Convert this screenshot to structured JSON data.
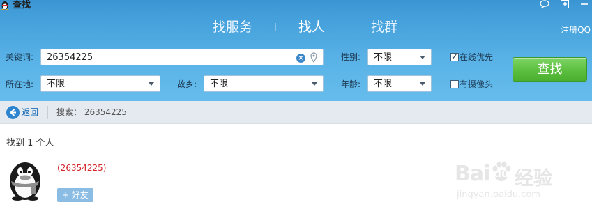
{
  "window": {
    "title": "查找",
    "controls": {
      "feedback_icon": "chat-bubble-icon",
      "add_icon": "plus-icon",
      "minimize_icon": "minimize-icon"
    }
  },
  "nav": {
    "tabs": [
      {
        "label": "找服务",
        "active": false
      },
      {
        "label": "找人",
        "active": true
      },
      {
        "label": "找群",
        "active": false
      }
    ],
    "register_link": "注册QQ"
  },
  "form": {
    "keyword": {
      "label": "关键词:",
      "value": "26354225"
    },
    "gender": {
      "label": "性别:",
      "value": "不限"
    },
    "online_first": {
      "label": "在线优先",
      "checked": true
    },
    "location": {
      "label": "所在地:",
      "value": "不限"
    },
    "hometown": {
      "label": "故乡:",
      "value": "不限"
    },
    "age": {
      "label": "年龄:",
      "value": "不限"
    },
    "has_camera": {
      "label": "有摄像头",
      "checked": false
    },
    "search_button": "查找",
    "checkmark": "✓",
    "clear_glyph": "×"
  },
  "breadcrumb": {
    "back_label": "返回",
    "search_text": "搜索： 26354225"
  },
  "results": {
    "count_text": "找到 1 个人",
    "items": [
      {
        "id_text": "(26354225)",
        "add_label": "+ 好友"
      }
    ]
  },
  "watermark": {
    "brand": "Bai",
    "brand2": "du",
    "cn": "经验",
    "url": "jingyan.baidu.com"
  },
  "colors": {
    "header_top": "#2f8ed0",
    "header_bottom": "#66bdec",
    "search_button": "#5cbf3f",
    "id_text": "#d4262c",
    "add_button": "#8bbce4",
    "link": "#1d6fb8"
  }
}
